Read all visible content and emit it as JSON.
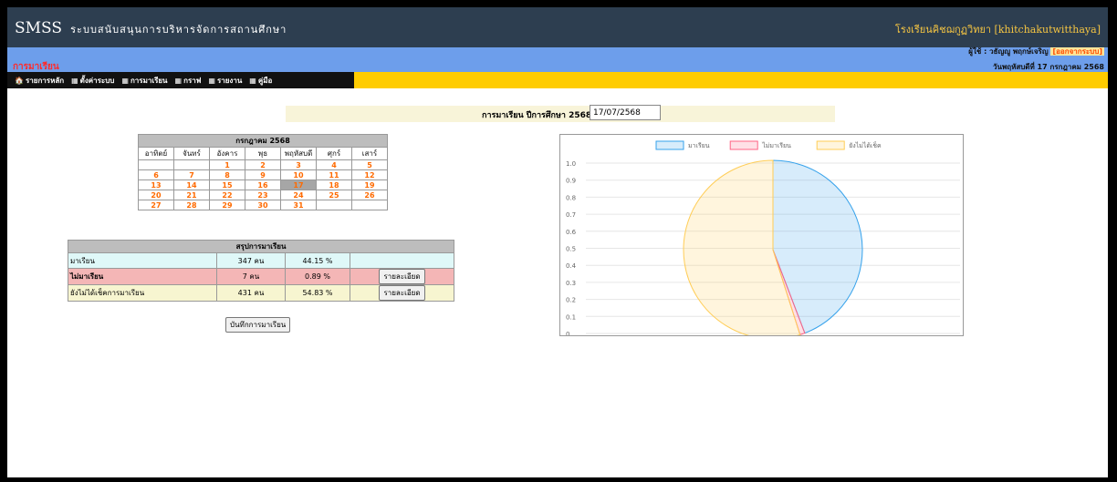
{
  "header": {
    "logo": "SMSS",
    "subtitle": "ระบบสนับสนุนการบริหารจัดการสถานศึกษา",
    "school": "โรงเรียนคิชฌกูฏวิทยา [khitchakutwitthaya]"
  },
  "user": {
    "label": "ผู้ใช้ : วธัญญู พฤกษ์เจริญ",
    "logout": "[ออกจากระบบ]"
  },
  "page": {
    "title": "การมาเรียน",
    "date": "วันพฤหัสบดีที่ 17 กรกฎาคม 2568"
  },
  "nav": [
    {
      "icon": "home-icon",
      "glyph": "🏠",
      "label": "รายการหลัก"
    },
    {
      "icon": "grid-icon",
      "glyph": "▦",
      "label": "ตั้งค่าระบบ"
    },
    {
      "icon": "grid-icon",
      "glyph": "▦",
      "label": "การมาเรียน"
    },
    {
      "icon": "grid-icon",
      "glyph": "▦",
      "label": "กราฟ"
    },
    {
      "icon": "grid-icon",
      "glyph": "▦",
      "label": "รายงาน"
    },
    {
      "icon": "grid-icon",
      "glyph": "▦",
      "label": "คู่มือ"
    }
  ],
  "attendance_title": "การมาเรียน ปีการศึกษา 2568",
  "date_input": "17/07/2568",
  "calendar": {
    "month": "กรกฎาคม 2568",
    "days": [
      "อาทิตย์",
      "จันทร์",
      "อังคาร",
      "พุธ",
      "พฤหัสบดี",
      "ศุกร์",
      "เสาร์"
    ],
    "weeks": [
      [
        "",
        "",
        "1",
        "2",
        "3",
        "4",
        "5"
      ],
      [
        "6",
        "7",
        "8",
        "9",
        "10",
        "11",
        "12"
      ],
      [
        "13",
        "14",
        "15",
        "16",
        "17",
        "18",
        "19"
      ],
      [
        "20",
        "21",
        "22",
        "23",
        "24",
        "25",
        "26"
      ],
      [
        "27",
        "28",
        "29",
        "30",
        "31",
        "",
        ""
      ]
    ],
    "today": "17"
  },
  "summary": {
    "title": "สรุปการมาเรียน",
    "rows": [
      {
        "label": "มาเรียน",
        "count": "347 คน",
        "percent": "44.15 %",
        "button": ""
      },
      {
        "label": "ไม่มาเรียน",
        "count": "7 คน",
        "percent": "0.89 %",
        "button": "รายละเอียด"
      },
      {
        "label": "ยังไม่ได้เช็คการมาเรียน",
        "count": "431 คน",
        "percent": "54.83 %",
        "button": "รายละเอียด"
      }
    ]
  },
  "save_button": "บันทึกการมาเรียน",
  "colors": {
    "present": "#36a2eb",
    "absent": "#ff6384",
    "unchecked": "#ffcd56"
  },
  "chart_data": {
    "type": "pie",
    "categories": [
      "มาเรียน",
      "ไม่มาเรียน",
      "ยังไม่ได้เช็ค"
    ],
    "values": [
      44.15,
      0.89,
      54.83
    ],
    "axis_ticks": [
      "1.0",
      "0.9",
      "0.8",
      "0.7",
      "0.6",
      "0.5",
      "0.4",
      "0.3",
      "0.2",
      "0.1",
      "0"
    ],
    "legend": "top"
  }
}
